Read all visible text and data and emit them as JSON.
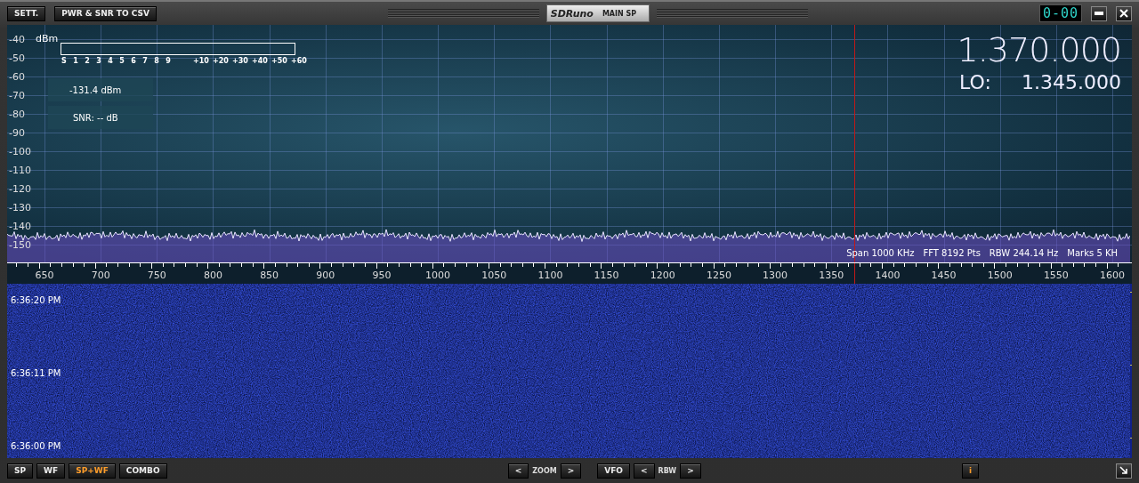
{
  "toolbar": {
    "buttons": [
      "SETT.",
      "PWR & SNR TO CSV"
    ],
    "app_name": "SDRuno",
    "panel_name": "MAIN SP",
    "clock": "0-00"
  },
  "spectrum": {
    "y_unit": "dBm",
    "y_labels": [
      "-40",
      "-50",
      "-60",
      "-70",
      "-80",
      "-90",
      "-100",
      "-110",
      "-120",
      "-130",
      "-140",
      "-150"
    ],
    "s_meter": {
      "scale": [
        "S",
        "1",
        "2",
        "3",
        "4",
        "5",
        "6",
        "7",
        "8",
        "9",
        "+10",
        "+20",
        "+30",
        "+40",
        "+50",
        "+60"
      ]
    },
    "power": "-131.4 dBm",
    "snr": "SNR: -- dB",
    "frequency": "1.370.000",
    "lo_label": "LO:",
    "lo_frequency": "1.345.000",
    "info": [
      "Span 1000 KHz",
      "FFT 8192 Pts",
      "RBW 244.14 Hz",
      "Marks 5 KH"
    ],
    "x_labels": [
      "650",
      "700",
      "750",
      "800",
      "850",
      "900",
      "950",
      "1000",
      "1050",
      "1100",
      "1150",
      "1200",
      "1250",
      "1300",
      "1350",
      "1400",
      "1450",
      "1500",
      "1550",
      "1600"
    ]
  },
  "waterfall": {
    "timestamps": [
      "6:36:20 PM",
      "6:36:11 PM",
      "6:36:00 PM"
    ]
  },
  "bottom_bar": {
    "modes": [
      {
        "label": "SP",
        "selected": false
      },
      {
        "label": "WF",
        "selected": false
      },
      {
        "label": "SP+WF",
        "selected": true
      },
      {
        "label": "COMBO",
        "selected": false
      }
    ],
    "zoom": {
      "prev": "<",
      "label": "ZOOM",
      "next": ">"
    },
    "vfo": "VFO",
    "rbw": {
      "prev": "<",
      "label": "RBW",
      "next": ">"
    },
    "info": "i"
  }
}
